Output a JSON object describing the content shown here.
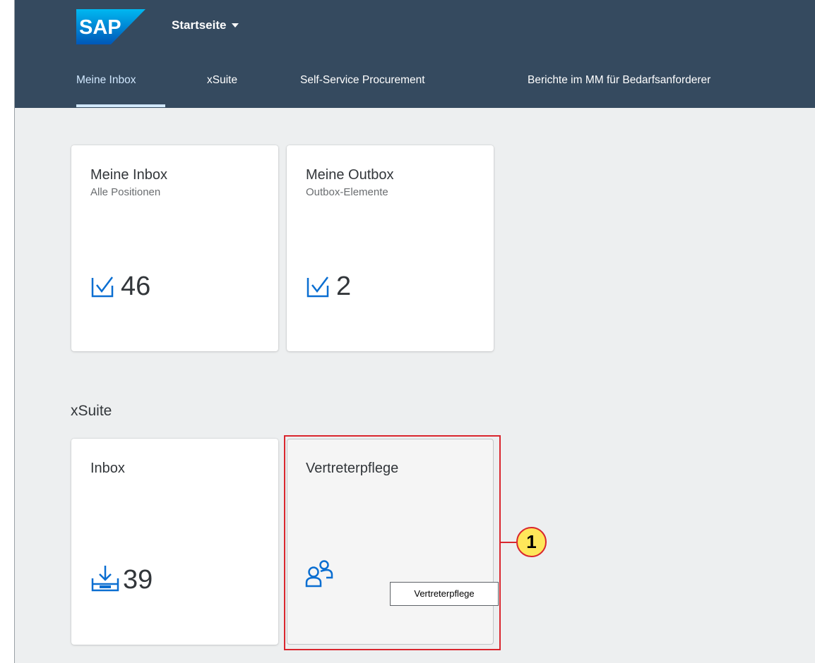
{
  "shell": {
    "logo_text": "SAP",
    "home_title": "Startseite",
    "tabs": [
      {
        "label": "Meine Inbox",
        "active": true
      },
      {
        "label": "xSuite",
        "active": false
      },
      {
        "label": "Self-Service Procurement",
        "active": false
      },
      {
        "label": "Berichte im MM für Bedarfsanforderer",
        "active": false
      }
    ]
  },
  "groups": {
    "inbox_group": {
      "tiles": [
        {
          "title": "Meine Inbox",
          "subtitle": "Alle Positionen",
          "icon": "task-check-icon",
          "number": "46"
        },
        {
          "title": "Meine Outbox",
          "subtitle": "Outbox-Elemente",
          "icon": "task-check-icon",
          "number": "2"
        }
      ]
    },
    "xsuite_group": {
      "title": "xSuite",
      "tiles": [
        {
          "title": "Inbox",
          "icon": "inbox-download-icon",
          "number": "39"
        },
        {
          "title": "Vertreterpflege",
          "icon": "people-icon",
          "tooltip": "Vertreterpflege"
        }
      ]
    }
  },
  "annotation": {
    "callout_number": "1"
  },
  "colors": {
    "shell_bg": "#354a5f",
    "content_bg": "#edeff0",
    "tile_bg": "#ffffff",
    "icon_blue": "#0a6ed1",
    "highlight_red": "#d9262e",
    "callout_yellow": "#ffe75a"
  }
}
